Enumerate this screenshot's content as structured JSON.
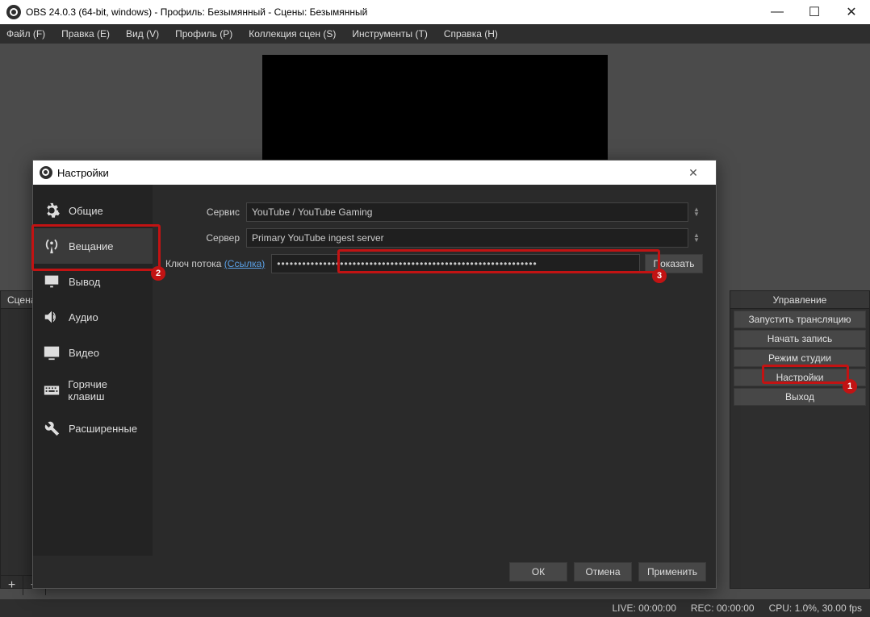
{
  "window": {
    "title": "OBS 24.0.3 (64-bit, windows) - Профиль: Безымянный - Сцены: Безымянный"
  },
  "menu": {
    "file": "Файл (F)",
    "edit": "Правка (E)",
    "view": "Вид (V)",
    "profile": "Профиль (P)",
    "scene_collection": "Коллекция сцен (S)",
    "tools": "Инструменты (T)",
    "help": "Справка (H)"
  },
  "scenes": {
    "header": "Сцена"
  },
  "controls": {
    "header": "Управление",
    "start_stream": "Запустить трансляцию",
    "start_record": "Начать запись",
    "studio_mode": "Режим студии",
    "settings": "Настройки",
    "exit": "Выход"
  },
  "status": {
    "live": "LIVE: 00:00:00",
    "rec": "REC: 00:00:00",
    "cpu": "CPU: 1.0%, 30.00 fps"
  },
  "dialog": {
    "title": "Настройки",
    "sidebar": {
      "general": "Общие",
      "stream": "Вещание",
      "output": "Вывод",
      "audio": "Аудио",
      "video": "Видео",
      "hotkeys": "Горячие клавиш",
      "advanced": "Расширенные"
    },
    "form": {
      "service_label": "Сервис",
      "service_value": "YouTube / YouTube Gaming",
      "server_label": "Сервер",
      "server_value": "Primary YouTube ingest server",
      "key_label": "Ключ потока",
      "key_link": "(Ссылка)",
      "key_value": "••••••••••••••••••••••••••••••••••••••••••••••••••••••••••••••",
      "show_btn": "Показать"
    },
    "buttons": {
      "ok": "ОК",
      "cancel": "Отмена",
      "apply": "Применить"
    }
  }
}
